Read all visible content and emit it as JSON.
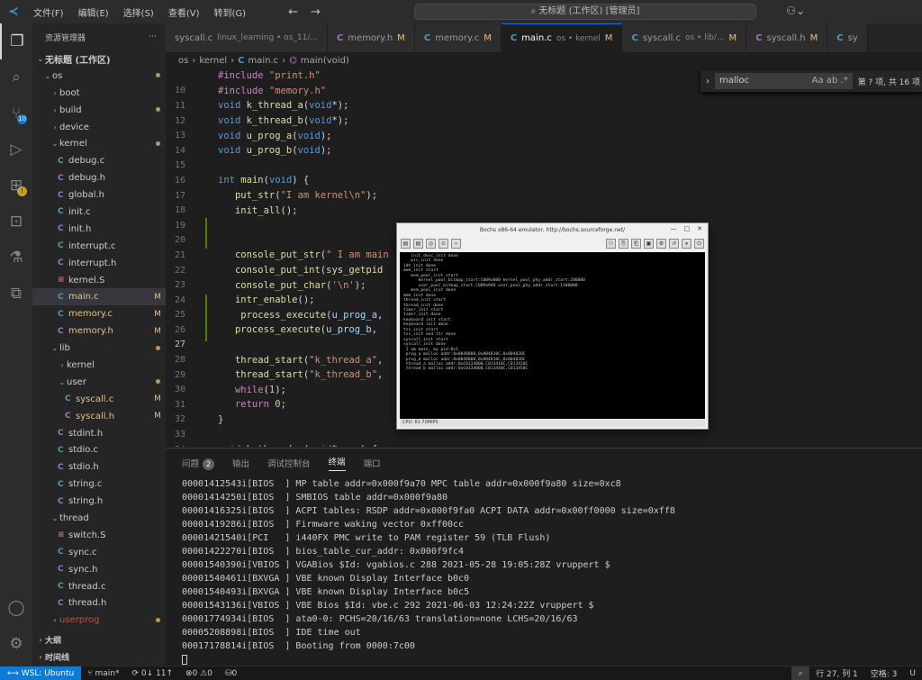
{
  "titlebar": {
    "menu": [
      "文件(F)",
      "编辑(E)",
      "选择(S)",
      "查看(V)",
      "转到(G)"
    ],
    "command_center": "无标题 (工作区) [管理员]"
  },
  "sidebar": {
    "title": "资源管理器",
    "more": "···",
    "workspace": "无标题 (工作区)",
    "footer": [
      "大纲",
      "时间线"
    ]
  },
  "tree": [
    {
      "name": "os",
      "type": "folder",
      "depth": 1,
      "open": true,
      "status": "dot"
    },
    {
      "name": "boot",
      "type": "folder",
      "depth": 2,
      "open": false,
      "status": ""
    },
    {
      "name": "build",
      "type": "folder",
      "depth": 2,
      "open": false,
      "status": "dot"
    },
    {
      "name": "device",
      "type": "folder",
      "depth": 2,
      "open": false,
      "status": ""
    },
    {
      "name": "kernel",
      "type": "folder",
      "depth": 2,
      "open": true,
      "status": "dot"
    },
    {
      "name": "debug.c",
      "type": "c",
      "depth": 3,
      "status": ""
    },
    {
      "name": "debug.h",
      "type": "h",
      "depth": 3,
      "status": ""
    },
    {
      "name": "global.h",
      "type": "h",
      "depth": 3,
      "status": ""
    },
    {
      "name": "init.c",
      "type": "c",
      "depth": 3,
      "status": ""
    },
    {
      "name": "init.h",
      "type": "h",
      "depth": 3,
      "status": ""
    },
    {
      "name": "interrupt.c",
      "type": "c",
      "depth": 3,
      "status": ""
    },
    {
      "name": "interrupt.h",
      "type": "h",
      "depth": 3,
      "status": ""
    },
    {
      "name": "kernel.S",
      "type": "s",
      "depth": 3,
      "status": ""
    },
    {
      "name": "main.c",
      "type": "c",
      "depth": 3,
      "status": "M",
      "selected": true
    },
    {
      "name": "memory.c",
      "type": "c",
      "depth": 3,
      "status": "M"
    },
    {
      "name": "memory.h",
      "type": "h",
      "depth": 3,
      "status": "M"
    },
    {
      "name": "lib",
      "type": "folder",
      "depth": 2,
      "open": true,
      "status": "dot"
    },
    {
      "name": "kernel",
      "type": "folder",
      "depth": 3,
      "open": false,
      "status": ""
    },
    {
      "name": "user",
      "type": "folder",
      "depth": 3,
      "open": true,
      "status": "dot"
    },
    {
      "name": "syscall.c",
      "type": "c",
      "depth": 4,
      "status": "M"
    },
    {
      "name": "syscall.h",
      "type": "h",
      "depth": 4,
      "status": "M"
    },
    {
      "name": "stdint.h",
      "type": "h",
      "depth": 3,
      "status": ""
    },
    {
      "name": "stdio.c",
      "type": "c",
      "depth": 3,
      "status": ""
    },
    {
      "name": "stdio.h",
      "type": "h",
      "depth": 3,
      "status": ""
    },
    {
      "name": "string.c",
      "type": "c",
      "depth": 3,
      "status": ""
    },
    {
      "name": "string.h",
      "type": "h",
      "depth": 3,
      "status": ""
    },
    {
      "name": "thread",
      "type": "folder",
      "depth": 2,
      "open": true,
      "status": ""
    },
    {
      "name": "switch.S",
      "type": "s",
      "depth": 3,
      "status": ""
    },
    {
      "name": "sync.c",
      "type": "c",
      "depth": 3,
      "status": ""
    },
    {
      "name": "sync.h",
      "type": "h",
      "depth": 3,
      "status": ""
    },
    {
      "name": "thread.c",
      "type": "c",
      "depth": 3,
      "status": ""
    },
    {
      "name": "thread.h",
      "type": "h",
      "depth": 3,
      "status": ""
    },
    {
      "name": "userprog",
      "type": "folder",
      "depth": 2,
      "open": false,
      "status": "dot",
      "deleted": true
    }
  ],
  "tabs": [
    {
      "label": "syscall.c",
      "desc": "linux_learning • os_11/...",
      "type": "plain",
      "mark": ""
    },
    {
      "label": "memory.h",
      "desc": "",
      "type": "h",
      "mark": "M"
    },
    {
      "label": "memory.c",
      "desc": "",
      "type": "c",
      "mark": "M"
    },
    {
      "label": "main.c",
      "desc": "os • kernel",
      "type": "c",
      "mark": "M",
      "active": true
    },
    {
      "label": "syscall.c",
      "desc": "os • lib/...",
      "type": "c",
      "mark": "M"
    },
    {
      "label": "syscall.h",
      "desc": "",
      "type": "h",
      "mark": "M"
    },
    {
      "label": "sy",
      "desc": "",
      "type": "c",
      "mark": ""
    }
  ],
  "breadcrumb": [
    "os",
    "kernel",
    "main.c",
    "main(void)"
  ],
  "find": {
    "value": "malloc",
    "options": "Aa ab .*",
    "result": "第 ? 项, 共 16 项"
  },
  "code": [
    {
      "n": "",
      "t": [
        [
          "pp",
          "#include "
        ],
        [
          "str",
          "\"print.h\""
        ]
      ]
    },
    {
      "n": "10",
      "t": [
        [
          "pp",
          "#include "
        ],
        [
          "str",
          "\"memory.h\""
        ]
      ]
    },
    {
      "n": "11",
      "t": [
        [
          "kw",
          "void "
        ],
        [
          "fn",
          "k_thread_a"
        ],
        [
          "code",
          "("
        ],
        [
          "kw",
          "void"
        ],
        [
          "code",
          "*);"
        ]
      ]
    },
    {
      "n": "12",
      "t": [
        [
          "kw",
          "void "
        ],
        [
          "fn",
          "k_thread_b"
        ],
        [
          "code",
          "("
        ],
        [
          "kw",
          "void"
        ],
        [
          "code",
          "*);"
        ]
      ]
    },
    {
      "n": "13",
      "t": [
        [
          "kw",
          "void "
        ],
        [
          "fn",
          "u_prog_a"
        ],
        [
          "code",
          "("
        ],
        [
          "kw",
          "void"
        ],
        [
          "code",
          ");"
        ]
      ]
    },
    {
      "n": "14",
      "t": [
        [
          "kw",
          "void "
        ],
        [
          "fn",
          "u_prog_b"
        ],
        [
          "code",
          "("
        ],
        [
          "kw",
          "void"
        ],
        [
          "code",
          ");"
        ]
      ]
    },
    {
      "n": "15",
      "t": []
    },
    {
      "n": "16",
      "t": [
        [
          "kw",
          "int "
        ],
        [
          "fn",
          "main"
        ],
        [
          "code",
          "("
        ],
        [
          "kw",
          "void"
        ],
        [
          "code",
          ") {"
        ]
      ]
    },
    {
      "n": "17",
      "t": [
        [
          "code",
          "   "
        ],
        [
          "fn",
          "put_str"
        ],
        [
          "code",
          "("
        ],
        [
          "str",
          "\"I am kernel\\n\""
        ],
        [
          "code",
          ");"
        ]
      ]
    },
    {
      "n": "18",
      "t": [
        [
          "code",
          "   "
        ],
        [
          "fn",
          "init_all"
        ],
        [
          "code",
          "();"
        ]
      ]
    },
    {
      "n": "19",
      "t": []
    },
    {
      "n": "20",
      "t": []
    },
    {
      "n": "21",
      "t": [
        [
          "code",
          "   "
        ],
        [
          "fn",
          "console_put_str"
        ],
        [
          "code",
          "("
        ],
        [
          "str",
          "\" I am main"
        ]
      ]
    },
    {
      "n": "22",
      "t": [
        [
          "code",
          "   "
        ],
        [
          "fn",
          "console_put_int"
        ],
        [
          "code",
          "("
        ],
        [
          "fn",
          "sys_getpid"
        ]
      ]
    },
    {
      "n": "23",
      "t": [
        [
          "code",
          "   "
        ],
        [
          "fn",
          "console_put_char"
        ],
        [
          "code",
          "("
        ],
        [
          "str",
          "'\\n'"
        ],
        [
          "code",
          ");"
        ]
      ]
    },
    {
      "n": "24",
      "t": [
        [
          "code",
          "   "
        ],
        [
          "fn",
          "intr_enable"
        ],
        [
          "code",
          "();"
        ]
      ]
    },
    {
      "n": "25",
      "t": [
        [
          "code",
          "    "
        ],
        [
          "fn",
          "process_execute"
        ],
        [
          "code",
          "("
        ],
        [
          "var",
          "u_prog_a"
        ],
        [
          "code",
          ","
        ]
      ]
    },
    {
      "n": "26",
      "t": [
        [
          "code",
          "   "
        ],
        [
          "fn",
          "process_execute"
        ],
        [
          "code",
          "("
        ],
        [
          "var",
          "u_prog_b"
        ],
        [
          "code",
          ","
        ]
      ]
    },
    {
      "n": "27",
      "t": [],
      "current": true
    },
    {
      "n": "28",
      "t": [
        [
          "code",
          "   "
        ],
        [
          "fn",
          "thread_start"
        ],
        [
          "code",
          "("
        ],
        [
          "str",
          "\"k_thread_a\""
        ],
        [
          "code",
          ","
        ]
      ]
    },
    {
      "n": "29",
      "t": [
        [
          "code",
          "   "
        ],
        [
          "fn",
          "thread_start"
        ],
        [
          "code",
          "("
        ],
        [
          "str",
          "\"k_thread_b\""
        ],
        [
          "code",
          ","
        ]
      ]
    },
    {
      "n": "30",
      "t": [
        [
          "code",
          "   "
        ],
        [
          "pp",
          "while"
        ],
        [
          "code",
          "("
        ],
        [
          "num",
          "1"
        ],
        [
          "code",
          ");"
        ]
      ]
    },
    {
      "n": "31",
      "t": [
        [
          "code",
          "   "
        ],
        [
          "pp",
          "return "
        ],
        [
          "num",
          "0"
        ],
        [
          "code",
          ";"
        ]
      ]
    },
    {
      "n": "32",
      "t": [
        [
          "code",
          "}"
        ]
      ]
    },
    {
      "n": "33",
      "t": []
    },
    {
      "n": "34",
      "t": [
        [
          "kw",
          "void "
        ],
        [
          "fn",
          "k_thread_a"
        ],
        [
          "code",
          "("
        ],
        [
          "kw",
          "void"
        ],
        [
          "code",
          "* "
        ],
        [
          "var",
          "arg"
        ],
        [
          "code",
          ") {"
        ]
      ]
    }
  ],
  "bochs": {
    "title": "Bochs x86-64 emulator, http://bochs.sourceforge.net/",
    "controls": [
      "—",
      "□",
      "✕"
    ],
    "screen": [
      "   init_desc_init done",
      "   pic_init done",
      "idt_init done",
      "mem_init start",
      "   mem_pool_init start",
      "      kernel_pool_bitmap_start:C009a000 kernel_pool_phy_addr_start:200000",
      "      user_pool_bitmap_start:C009a9d0 user_pool_phy_addr_start:1100000",
      "   mem_pool_init done",
      "mem_init done",
      "thread_init start",
      "thread_init done",
      "timer_init start",
      "timer_init done",
      "keyboard init start",
      "keyboard init done",
      "tss_init start",
      "tss_init and ltr done",
      "syscall_init start",
      "syscall_init done",
      " I am main, my pid:0x1",
      " prog_a malloc addr:0x8048000,0x804810C,0x804820C",
      " prog_b malloc addr:0x8048000,0x804810C,0x804820C",
      " thread_a malloc addr:0xC0134000,C013410C,C013420C",
      " thread_b malloc addr:0xC0134000,C013440C,C013450C"
    ],
    "status": "CPU: 61.70MIPS"
  },
  "panel": {
    "tabs": [
      "问题",
      "输出",
      "调试控制台",
      "终端",
      "端口"
    ],
    "problems_count": "2",
    "active_tab": "终端",
    "lines": [
      "00001412543i[BIOS  ] MP table addr=0x000f9a70 MPC table addr=0x000f9a80 size=0xc8",
      "00001414250i[BIOS  ] SMBIOS table addr=0x000f9a80",
      "00001416325i[BIOS  ] ACPI tables: RSDP addr=0x000f9fa0 ACPI DATA addr=0x00ff0000 size=0xff8",
      "00001419286i[BIOS  ] Firmware waking vector 0xff00cc",
      "00001421540i[PCI   ] i440FX PMC write to PAM register 59 (TLB Flush)",
      "00001422270i[BIOS  ] bios_table_cur_addr: 0x000f9fc4",
      "00001540390i[VBIOS ] VGABios $Id: vgabios.c 288 2021-05-28 19:05:28Z vruppert $",
      "00001540461i[BXVGA ] VBE known Display Interface b0c0",
      "00001540493i[BXVGA ] VBE known Display Interface b0c5",
      "00001543136i[VBIOS ] VBE Bios $Id: vbe.c 292 2021-06-03 12:24:22Z vruppert $",
      "00001774934i[BIOS  ] ata0-0: PCHS=20/16/63 translation=none LCHS=20/16/63",
      "00005208898i[BIOS  ] IDE time out",
      "00017178814i[BIOS  ] Booting from 0000:7c00"
    ]
  },
  "statusbar": {
    "remote": "WSL: Ubuntu",
    "branch": "main*",
    "sync": "0↓ 11↑",
    "problems": "⊗0 ⚠0",
    "ports": "⛁0",
    "position": "行 27, 列 1",
    "spaces": "空格: 3",
    "encoding": "U"
  }
}
